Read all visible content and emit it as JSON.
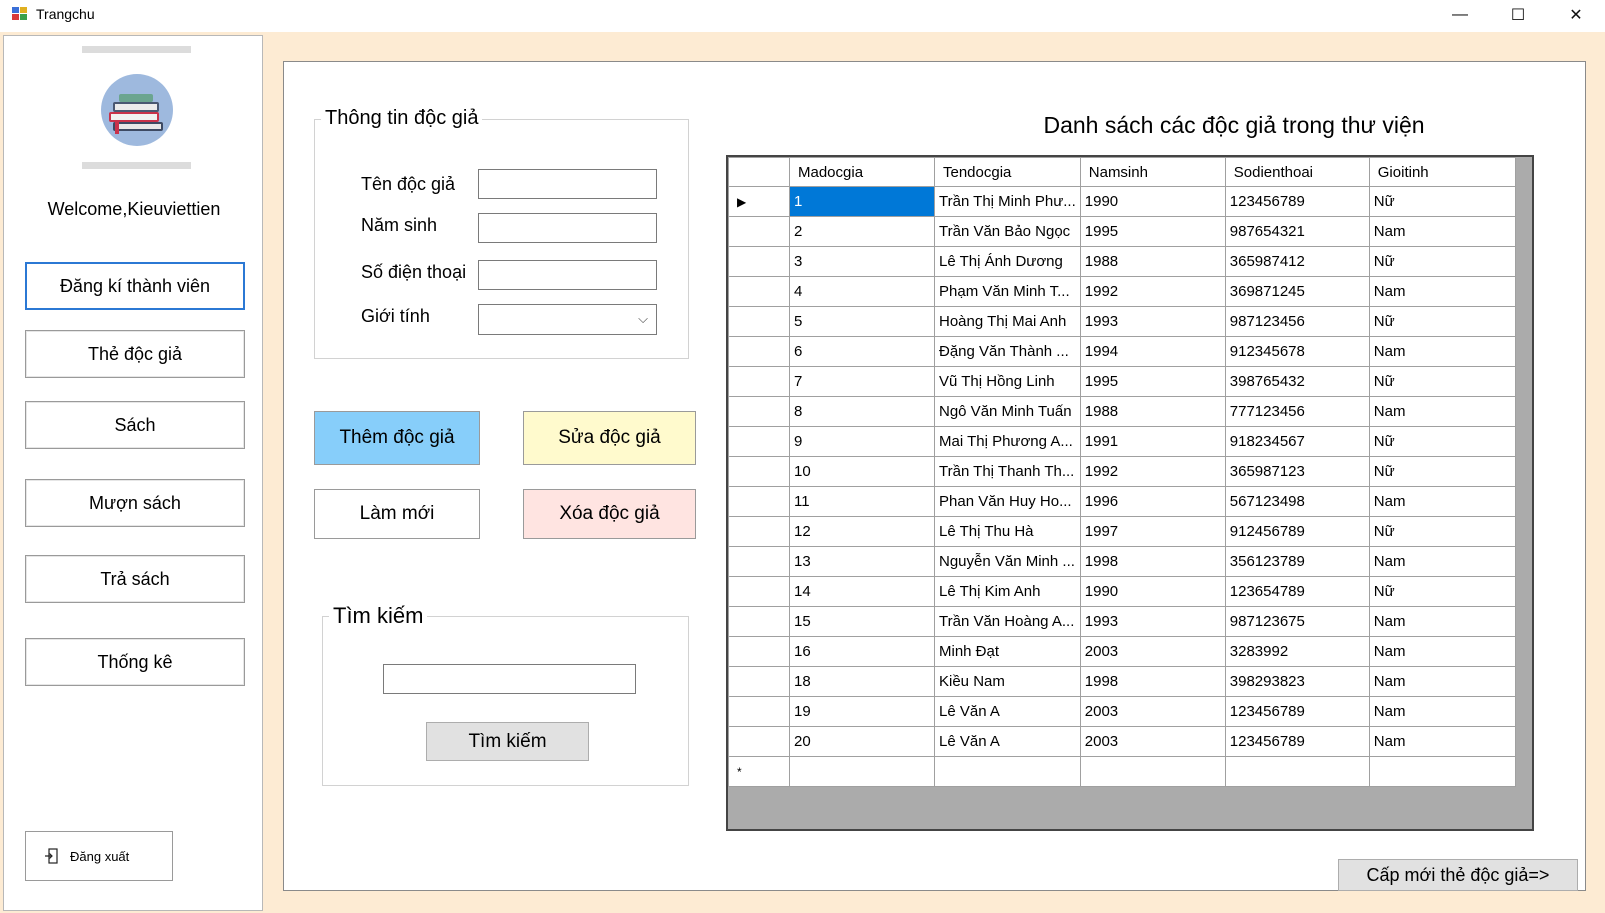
{
  "window": {
    "title": "Trangchu",
    "minimize_glyph": "—",
    "maximize_glyph": "☐",
    "close_glyph": "✕"
  },
  "sidebar": {
    "welcome": "Welcome,Kieuviettien",
    "items": [
      {
        "label": "Đăng kí thành viên",
        "active": true
      },
      {
        "label": "Thẻ độc giả"
      },
      {
        "label": "Sách"
      },
      {
        "label": "Mượn sách"
      },
      {
        "label": "Trả sách"
      },
      {
        "label": "Thống kê"
      }
    ],
    "logout_label": "Đăng xuất",
    "logout_icon": "logout-icon"
  },
  "reader_form": {
    "group_title": "Thông tin độc giả",
    "name_label": "Tên độc giả",
    "name_value": "",
    "birth_year_label": "Năm sinh",
    "birth_year_value": "",
    "phone_label": "Số điện thoại",
    "phone_value": "",
    "gender_label": "Giới tính",
    "gender_value": ""
  },
  "actions": {
    "add_label": "Thêm độc giả",
    "edit_label": "Sửa độc giả",
    "refresh_label": "Làm mới",
    "delete_label": "Xóa độc giả",
    "add_color": "#87cefa",
    "edit_color": "#fffacd",
    "delete_color": "#ffe4e1"
  },
  "search": {
    "group_title": "Tìm kiếm",
    "input_value": "",
    "button_label": "Tìm kiếm"
  },
  "grid": {
    "title": "Danh sách các độc giả trong thư viện",
    "columns": [
      "Madocgia",
      "Tendocgia",
      "Namsinh",
      "Sodienthoai",
      "Gioitinh"
    ],
    "rows": [
      [
        "1",
        "Trần Thị Minh Phư...",
        "1990",
        "123456789",
        "Nữ"
      ],
      [
        "2",
        "Trần Văn Bảo Ngọc",
        "1995",
        "987654321",
        "Nam"
      ],
      [
        "3",
        "Lê Thị Ánh Dương",
        "1988",
        "365987412",
        "Nữ"
      ],
      [
        "4",
        "Phạm Văn Minh T...",
        "1992",
        "369871245",
        "Nam"
      ],
      [
        "5",
        "Hoàng Thị Mai Anh",
        "1993",
        "987123456",
        "Nữ"
      ],
      [
        "6",
        "Đặng Văn Thành ...",
        "1994",
        "912345678",
        "Nam"
      ],
      [
        "7",
        "Vũ Thị Hồng Linh",
        "1995",
        "398765432",
        "Nữ"
      ],
      [
        "8",
        "Ngô Văn Minh Tuấn",
        "1988",
        "777123456",
        "Nam"
      ],
      [
        "9",
        "Mai Thị Phương A...",
        "1991",
        "918234567",
        "Nữ"
      ],
      [
        "10",
        "Trần Thị Thanh Th...",
        "1992",
        "365987123",
        "Nữ"
      ],
      [
        "11",
        "Phan Văn Huy Ho...",
        "1996",
        "567123498",
        "Nam"
      ],
      [
        "12",
        "Lê Thị Thu Hà",
        "1997",
        "912456789",
        "Nữ"
      ],
      [
        "13",
        "Nguyễn Văn Minh ...",
        "1998",
        "356123789",
        "Nam"
      ],
      [
        "14",
        "Lê Thị Kim Anh",
        "1990",
        "123654789",
        "Nữ"
      ],
      [
        "15",
        "Trần Văn Hoàng A...",
        "1993",
        "987123675",
        "Nam"
      ],
      [
        "16",
        "Minh Đạt",
        "2003",
        "3283992",
        "Nam"
      ],
      [
        "18",
        "Kiều Nam",
        "1998",
        "398293823",
        "Nam"
      ],
      [
        "19",
        "Lê Văn A",
        "2003",
        "123456789",
        "Nam"
      ],
      [
        "20",
        "Lê Văn A",
        "2003",
        "123456789",
        "Nam"
      ]
    ],
    "current_row_glyph": "▶",
    "new_row_glyph": "*",
    "selected_color": "#0078d7"
  },
  "footer": {
    "issue_card_label": "Cấp mới thẻ độc giả=>"
  }
}
